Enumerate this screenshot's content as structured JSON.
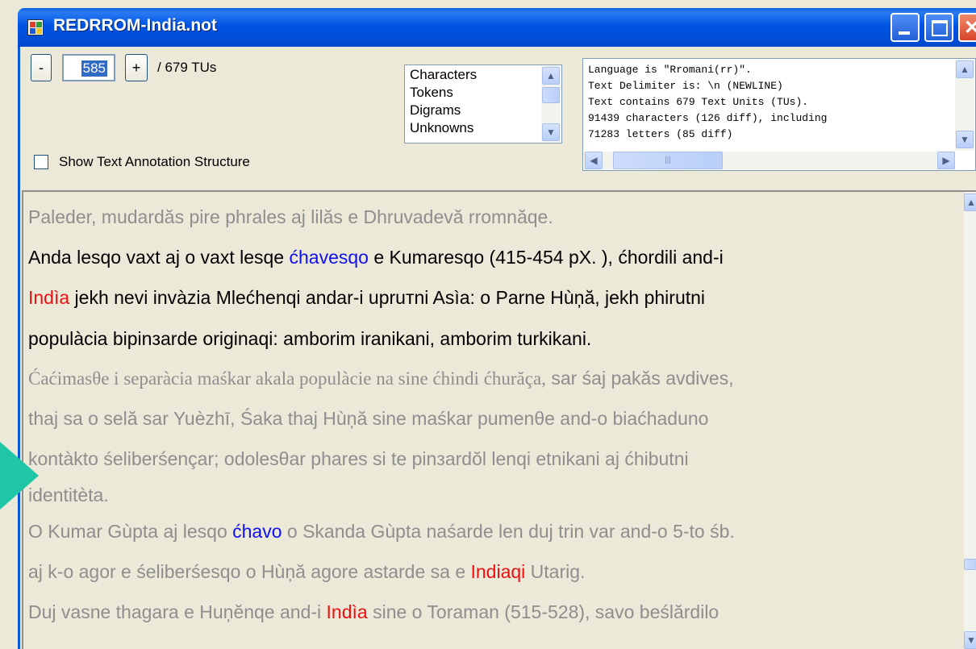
{
  "window": {
    "title": "REDRROM-India.not"
  },
  "navigator": {
    "minus_label": "-",
    "current_value": "585",
    "plus_label": "+",
    "total_label": "/ 679 TUs"
  },
  "options": {
    "show_annotation_label": "Show Text Annotation Structure",
    "show_annotation_checked": false
  },
  "listbox": {
    "items": [
      "Characters",
      "Tokens",
      "Digrams",
      "Unknowns"
    ]
  },
  "info": {
    "lines": [
      "Language is \"Rromani(rr)\".",
      "Text Delimiter is: \\n (NEWLINE)",
      "Text contains 679 Text Units (TUs).",
      "91439 characters (126 diff), including",
      "   71283 letters   (85 diff)"
    ],
    "hscroll_thumb_glyph": "|||"
  },
  "text": {
    "l1": "Paleder, mudardăs pire phrales aj lilăs e Dhruvadevă rromnăqe.",
    "l2a": "Anda lesqo vaxt aj o vaxt lesqe ",
    "l2b": "ćhavesqo",
    "l2c": " e Kumaresqo (415-454 pX. ), ćhordili and-i",
    "l3a": "Indìa",
    "l3b": " jekh nevi invàzia Mlećhenqi andar-i upruтni Asìa: o Parne Hùņă, jekh phirutni",
    "l4": "populàcia bipinзarde originaqi: amborim iranikani, amborim turkikani.",
    "l5a": "Ćaćimasθe i separàcia maśkar akala populàcie na sine ćhindi ćhurăça,",
    "l5b": " sar śaj pakăs avdives,",
    "l6": "thaj sa o selă sar Yuèzhī, Śaka thaj Hùņă sine maśkar pumenθe and-o biaćhaduno",
    "l7": "kontàkto śeliberśençar; odolesθar phares si te pinзardŏl lenqi etnikani aj ćhibutni",
    "l8": "identitèta.",
    "l9a": "O Kumar Gùpta aj lesqo ",
    "l9b": "ćhavo",
    "l9c": " o Skanda Gùpta naśarde len duj trin var and-o 5-to śb.",
    "l10a": "aj k-o agor e śeliberśesqo o Hùņă agore astarde sa e ",
    "l10b": "Indiaqi",
    "l10c": " Utarig.",
    "l11a": "Duj vasne thagara e Huņĕnqe and-i ",
    "l11b": "Indìa",
    "l11c": " sine o Toraman (515-528), savo beślărdilo"
  },
  "colors": {
    "title_bar": "#0055e5",
    "highlight_blue": "#1010ee",
    "highlight_red": "#ee1010",
    "arrow": "#1ec6a6"
  }
}
